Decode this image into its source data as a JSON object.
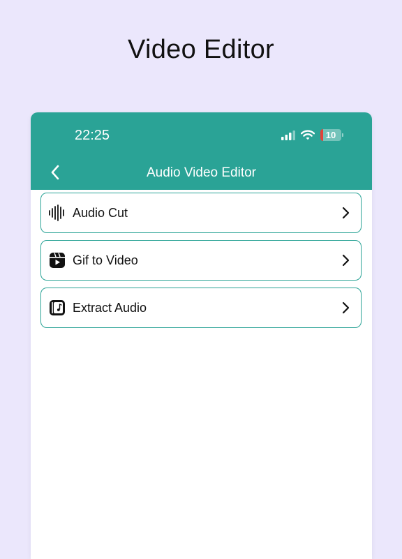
{
  "headline": "Video Editor",
  "status_bar": {
    "time": "22:25",
    "battery": "10",
    "icons": [
      "signal-icon",
      "wifi-icon",
      "battery-icon"
    ]
  },
  "app_bar": {
    "title": "Audio Video Editor",
    "back_icon": "chevron-left-icon",
    "color": "#2aa396"
  },
  "menu": {
    "items": [
      {
        "label": "Audio Cut",
        "icon": "waveform-icon"
      },
      {
        "label": "Gif to Video",
        "icon": "video-play-icon"
      },
      {
        "label": "Extract Audio",
        "icon": "music-file-icon"
      }
    ]
  },
  "colors": {
    "background": "#ebe7fc",
    "accent": "#2aa396",
    "battery_low": "#e0433a"
  }
}
